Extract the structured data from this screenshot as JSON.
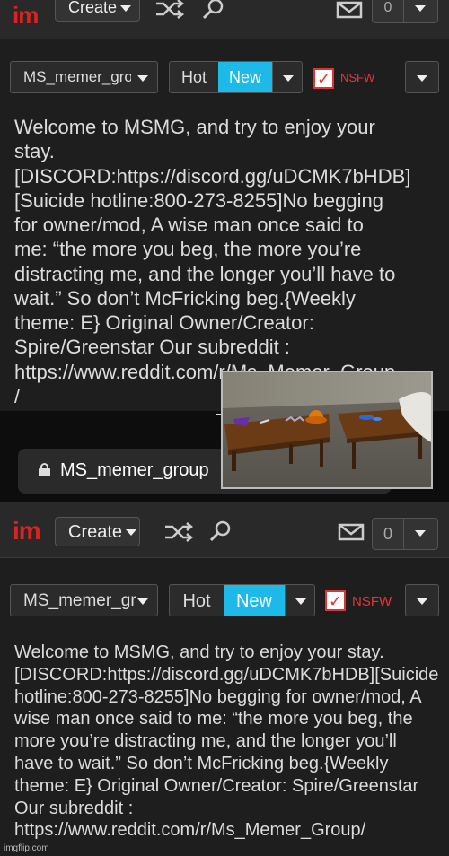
{
  "header": {
    "logo_i": "i",
    "logo_m": "m",
    "create_label": "Create",
    "notification_count": "0"
  },
  "controls": {
    "group_name": "MS_memer_group",
    "sort_hot": "Hot",
    "sort_new": "New",
    "nsfw_label": "NSFW",
    "nsfw_checked": true
  },
  "description": "Welcome to MSMG, and try to enjoy your stay. [DISCORD:https://discord.gg/uDCMK7bHDB][Suicide hotline:800-273-8255]No begging for owner/mod, A wise man once said to me: “the more you beg, the more you’re distracting me, and the longer you’ll have to wait.” So don’t McFricking beg.{Weekly theme: E} Original Owner/Creator: Spire/Greenstar Our subreddit : https://www.reddit.com/r/Ms_Memer_Group/",
  "description_top_lines": [
    "Welcome to MSMG, and try to enjoy your",
    "stay.",
    "[DISCORD:https://discord.gg/uDCMK7bHDB]",
    "[Suicide hotline:800-273-8255]No begging",
    "for owner/mod, A wise man once said to",
    "me: “the more you beg, the more you’re",
    "distracting me, and the longer you’ll have to",
    "wait.” So don’t McFricking beg.{Weekly",
    "theme: E} Original Owner/Creator:",
    "Spire/Greenstar Our subreddit :",
    "https://www.reddit.com/r/Ms_Memer_Group",
    "/"
  ],
  "browser": {
    "url_text": "MS_memer_group"
  },
  "watermark": "imgflip.com",
  "colors": {
    "accent": "#1db9e8",
    "brand_red": "#dd2222",
    "nsfw_red": "#e33333",
    "background": "#1e1e1e"
  }
}
